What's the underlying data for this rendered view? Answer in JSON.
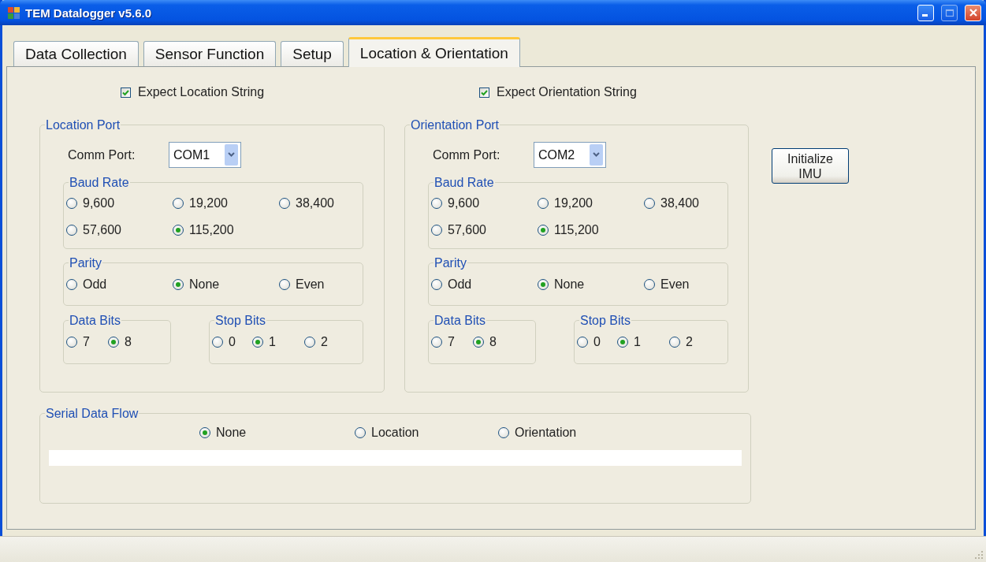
{
  "window": {
    "title": "TEM Datalogger v5.6.0"
  },
  "tabs": [
    {
      "label": "Data Collection",
      "selected": false
    },
    {
      "label": "Sensor Function",
      "selected": false
    },
    {
      "label": "Setup",
      "selected": false
    },
    {
      "label": "Location & Orientation",
      "selected": true
    }
  ],
  "checkboxes": [
    {
      "label": "Expect Location String",
      "checked": true
    },
    {
      "label": "Expect Orientation String",
      "checked": true
    }
  ],
  "ports": [
    {
      "title": "Location Port",
      "comm_label": "Comm Port:",
      "comm_value": "COM1",
      "groups": [
        {
          "title": "Baud Rate",
          "options": [
            {
              "label": "9,600",
              "selected": false
            },
            {
              "label": "19,200",
              "selected": false
            },
            {
              "label": "38,400",
              "selected": false
            },
            {
              "label": "57,600",
              "selected": false
            },
            {
              "label": "115,200",
              "selected": true
            }
          ]
        },
        {
          "title": "Parity",
          "options": [
            {
              "label": "Odd",
              "selected": false
            },
            {
              "label": "None",
              "selected": true
            },
            {
              "label": "Even",
              "selected": false
            }
          ]
        },
        {
          "title": "Data Bits",
          "options": [
            {
              "label": "7",
              "selected": false
            },
            {
              "label": "8",
              "selected": true
            }
          ]
        },
        {
          "title": "Stop Bits",
          "options": [
            {
              "label": "0",
              "selected": false
            },
            {
              "label": "1",
              "selected": true
            },
            {
              "label": "2",
              "selected": false
            }
          ]
        }
      ]
    },
    {
      "title": "Orientation Port",
      "comm_label": "Comm Port:",
      "comm_value": "COM2",
      "groups": [
        {
          "title": "Baud Rate",
          "options": [
            {
              "label": "9,600",
              "selected": false
            },
            {
              "label": "19,200",
              "selected": false
            },
            {
              "label": "38,400",
              "selected": false
            },
            {
              "label": "57,600",
              "selected": false
            },
            {
              "label": "115,200",
              "selected": true
            }
          ]
        },
        {
          "title": "Parity",
          "options": [
            {
              "label": "Odd",
              "selected": false
            },
            {
              "label": "None",
              "selected": true
            },
            {
              "label": "Even",
              "selected": false
            }
          ]
        },
        {
          "title": "Data Bits",
          "options": [
            {
              "label": "7",
              "selected": false
            },
            {
              "label": "8",
              "selected": true
            }
          ]
        },
        {
          "title": "Stop Bits",
          "options": [
            {
              "label": "0",
              "selected": false
            },
            {
              "label": "1",
              "selected": true
            },
            {
              "label": "2",
              "selected": false
            }
          ]
        }
      ]
    }
  ],
  "initialize_button": "Initialize IMU",
  "serial_data_flow": {
    "title": "Serial Data Flow",
    "options": [
      {
        "label": "None",
        "selected": true
      },
      {
        "label": "Location",
        "selected": false
      },
      {
        "label": "Orientation",
        "selected": false
      }
    ]
  }
}
